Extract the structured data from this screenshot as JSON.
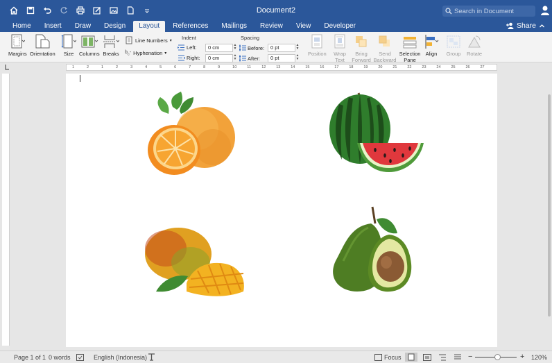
{
  "window": {
    "document_title": "Document2",
    "search_placeholder": "Search in Document"
  },
  "tabs": [
    {
      "label": "Home"
    },
    {
      "label": "Insert"
    },
    {
      "label": "Draw"
    },
    {
      "label": "Design"
    },
    {
      "label": "Layout",
      "active": true
    },
    {
      "label": "References"
    },
    {
      "label": "Mailings"
    },
    {
      "label": "Review"
    },
    {
      "label": "View"
    },
    {
      "label": "Developer"
    }
  ],
  "share_label": "Share",
  "ribbon": {
    "page_setup": {
      "margins": "Margins",
      "orientation": "Orientation",
      "size": "Size",
      "columns": "Columns",
      "breaks": "Breaks",
      "line_numbers": "Line Numbers",
      "hyphenation": "Hyphenation"
    },
    "indent": {
      "title": "Indent",
      "left_label": "Left:",
      "left_value": "0 cm",
      "right_label": "Right:",
      "right_value": "0 cm"
    },
    "spacing": {
      "title": "Spacing",
      "before_label": "Before:",
      "before_value": "0 pt",
      "after_label": "After:",
      "after_value": "0 pt"
    },
    "arrange": {
      "position": "Position",
      "wrap_text": "Wrap Text",
      "bring_forward": "Bring Forward",
      "send_backward": "Send Backward",
      "selection_pane": "Selection Pane",
      "align": "Align",
      "group": "Group",
      "rotate": "Rotate"
    }
  },
  "ruler_numbers": [
    "1",
    "2",
    "1",
    "2",
    "3",
    "4",
    "5",
    "6",
    "7",
    "8",
    "9",
    "10",
    "11",
    "12",
    "13",
    "14",
    "15",
    "16",
    "17",
    "18",
    "19",
    "20",
    "21",
    "22",
    "23",
    "24",
    "25",
    "26",
    "27"
  ],
  "document_images": [
    "orange",
    "watermelon",
    "mango",
    "avocado"
  ],
  "status": {
    "page": "Page 1 of 1",
    "words": "0 words",
    "language": "English (Indonesia)",
    "focus": "Focus",
    "zoom": "120%",
    "zoom_minus": "−",
    "zoom_plus": "+"
  },
  "colors": {
    "brand": "#2b579a"
  }
}
